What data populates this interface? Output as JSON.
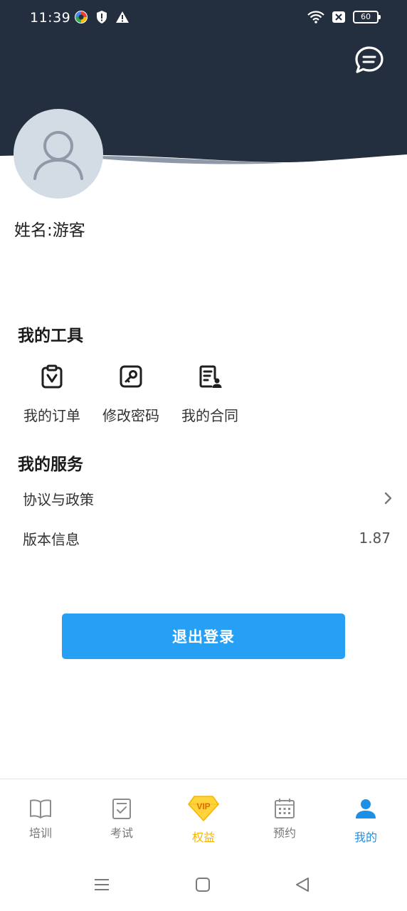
{
  "status_bar": {
    "time": "11:39",
    "battery": "60",
    "left_icons": [
      "app-color-icon",
      "shield-icon",
      "warning-icon"
    ],
    "right_icons": [
      "wifi-icon",
      "sim-off-icon",
      "battery-icon"
    ]
  },
  "header": {
    "background_color": "#232e3f",
    "message_icon": "chat-bubble-icon"
  },
  "profile": {
    "avatar_icon": "person-icon",
    "name_label": "姓名:游客"
  },
  "tools": {
    "title": "我的工具",
    "items": [
      {
        "label": "我的订单",
        "icon": "order-icon"
      },
      {
        "label": "修改密码",
        "icon": "key-icon"
      },
      {
        "label": "我的合同",
        "icon": "contract-icon"
      }
    ]
  },
  "services": {
    "title": "我的服务",
    "items": [
      {
        "label": "协议与政策",
        "icon": "chevron-right-icon"
      },
      {
        "label": "版本信息",
        "value": "1.87"
      }
    ]
  },
  "logout": {
    "label": "退出登录",
    "color": "#26a0f5"
  },
  "tabbar": {
    "active_color": "#1e8fe6",
    "vip_color": "#f5b400",
    "items": [
      {
        "label": "培训",
        "icon": "book-icon"
      },
      {
        "label": "考试",
        "icon": "exam-icon"
      },
      {
        "label": "权益",
        "icon": "vip-diamond-icon",
        "badge": "VIP"
      },
      {
        "label": "预约",
        "icon": "calendar-icon"
      },
      {
        "label": "我的",
        "icon": "user-icon",
        "active": true
      }
    ]
  },
  "system_nav": [
    "menu-icon",
    "home-icon",
    "back-icon"
  ]
}
